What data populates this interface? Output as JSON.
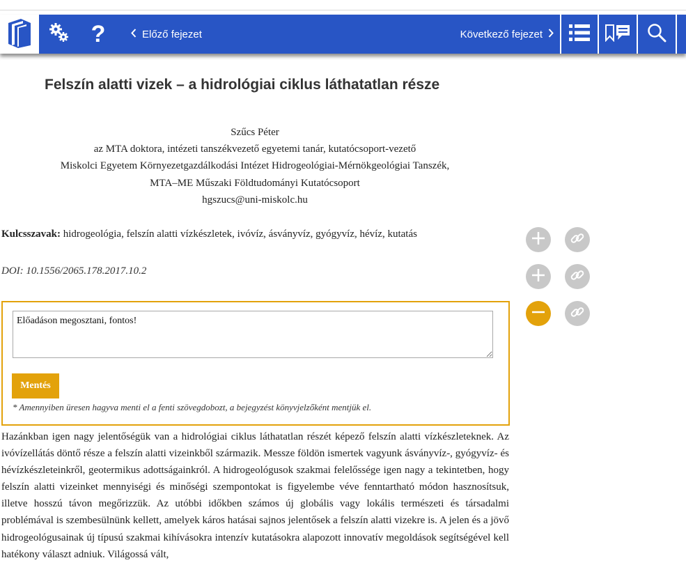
{
  "toolbar": {
    "prev_label": "Előző fejezet",
    "next_label": "Következő fejezet",
    "help_label": "?",
    "accent": "#2855c5"
  },
  "article": {
    "title": "Felszín alatti vizek – a hidrológiai ciklus láthatatlan része",
    "author": "Szűcs Péter",
    "author_lines": [
      "az MTA doktora, intézeti tanszékvezető egyetemi tanár, kutatócsoport-vezető",
      "Miskolci Egyetem Környezetgazdálkodási Intézet Hidrogeológiai-Mérnökgeológiai Tanszék,",
      "MTA–ME Műszaki Földtudományi Kutatócsoport",
      "hgszucs@uni-miskolc.hu"
    ],
    "keywords_label": "Kulcsszavak:",
    "keywords": "hidrogeológia, felszín alatti vízkészletek, ivóvíz, ásványvíz, gyógyvíz, hévíz, kutatás",
    "doi": "DOI: 10.1556/2065.178.2017.10.2"
  },
  "note": {
    "value": "Előadáson megosztani, fontos!",
    "save_label": "Mentés",
    "hint": "* Amennyiben üresen hagyva menti el a fenti szövegdobozt, a bejegyzést könyvjelzőként mentjük el.",
    "accent": "#e3a20b"
  },
  "body": {
    "paragraph": "Hazánkban igen nagy jelentőségük van a hidrológiai ciklus láthatatlan részét képező felszín alatti vízkészleteknek. Az ivóvízellátás döntő része a felszín alatti vizeinkből származik. Messze földön ismertek vagyunk ásványvíz-, gyógyvíz- és hévízkészleteinkről, geotermikus adottságainkról. A hidrogeológusok szakmai felelőssége igen nagy a tekintetben, hogy felszín alatti vizeinket mennyiségi és minőségi szempontokat is figyelembe véve fenntartható módon hasznosítsuk, illetve hosszú távon megőrizzük. Az utóbbi időkben számos új globális vagy lokális természeti és társadalmi problémával is szembesülnünk kellett, amelyek káros hatásai sajnos jelentősek a felszín alatti vizekre is. A jelen és a jövő hidrogeológusainak új típusú szakmai kihívásokra intenzív kutatásokra alapozott innovatív megoldások segítségével kell hatékony választ adniuk. Világossá vált,"
  },
  "icons": [
    "book-logo-icon",
    "gears-icon",
    "question-icon",
    "chevron-left-icon",
    "chevron-right-icon",
    "list-icon",
    "bookmark-comment-icon",
    "search-icon",
    "plus-icon",
    "minus-icon",
    "link-icon"
  ]
}
